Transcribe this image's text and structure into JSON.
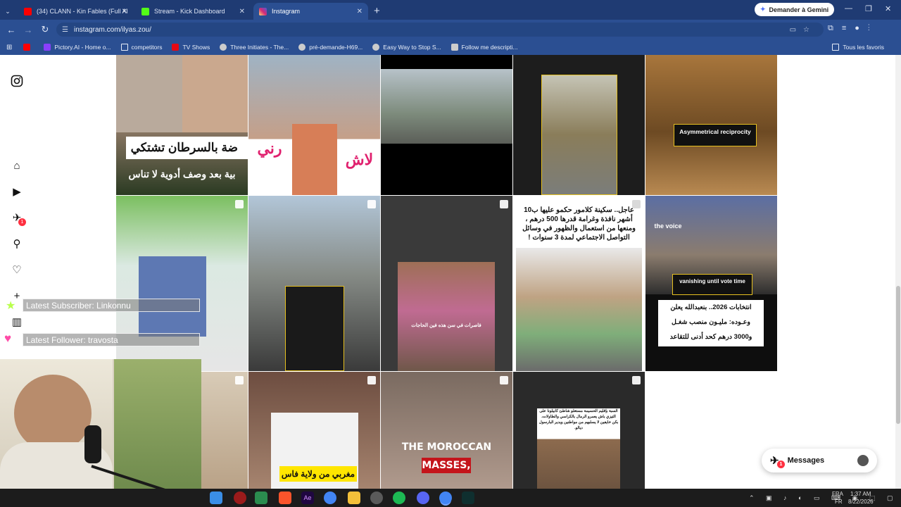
{
  "browser": {
    "tabs": [
      {
        "title": "(34) CLANN - Kin Fables (Full Al",
        "fav_color": "#ff0000",
        "active": false
      },
      {
        "title": "Stream - Kick Dashboard",
        "fav_color": "#53fc18",
        "active": false
      },
      {
        "title": "Instagram",
        "fav_color": "#d62976",
        "active": true
      }
    ],
    "new_tab": "+",
    "gemini_button": "Demander à Gemini",
    "url": "instagram.com/ilyas.zou/",
    "bookmarks": [
      {
        "label": "",
        "color": "#ff0000"
      },
      {
        "label": "Pictory.AI - Home o...",
        "color": "#8a3ffc"
      },
      {
        "label": "competitors",
        "color": "#e8c468"
      },
      {
        "label": "TV Shows",
        "color": "#e50914"
      },
      {
        "label": "Three Initiates - The...",
        "color": "#cccccc"
      },
      {
        "label": "pré-demande-H69...",
        "color": "#cccccc"
      },
      {
        "label": "Easy Way to Stop S...",
        "color": "#cccccc"
      },
      {
        "label": "Follow me descripti...",
        "color": "#cccccc"
      }
    ],
    "all_bookmarks": "Tous les favoris"
  },
  "instagram": {
    "notifications_badge": "1",
    "messages_label": "Messages",
    "messages_badge": "1",
    "posts": [
      {
        "caption": "ضة بالسرطان تشتكي\nبية بعد وصف أدوية لا تناس"
      },
      {
        "caption": "لاش\nنت ؟"
      },
      {
        "caption": ""
      },
      {
        "caption": ""
      },
      {
        "caption": "Asymmetrical reciprocity"
      },
      {
        "caption": ""
      },
      {
        "caption": ""
      },
      {
        "caption": "فاصرات في سن هذه فين الحاجات"
      },
      {
        "caption": "عاجل.. سكينة كلامور حكمو عليها ب10 أشهر نافذة وغرامة قدرها 500 درهم ، ومنعها من استعمال والظهور في وسائل التواصل الاجتماعي لمدة 3 سنوات !"
      },
      {
        "caption": "vanishing until vote time",
        "caption2": "انتخابات 2026.. بنعبدالله يعلن\nوعـوده: مليـون منصب شغـل\nو3000 درهم كحد أدنى للتقاعد",
        "logo": "the voice"
      },
      {
        "caption": ""
      },
      {
        "caption": "مغربي من ولاية فاس"
      },
      {
        "caption": "THE MOROCCAN",
        "caption2": "MASSES,"
      },
      {
        "caption": "السبة بإقليم الحسيمة مستغلو شاطئ كابيلونا على التيزي باش يعمرو الرمال بالكراسي والطاولات، بكن خايفين لا يسلبهم من مواطنين ويدير البارسول ديالو."
      }
    ]
  },
  "stream_overlay": {
    "subscriber": "Latest Subscriber: Linkonnu",
    "follower": "Latest Follower: travosta"
  },
  "taskbar": {
    "lang": "FRA",
    "region": "FR",
    "time": "1:37 AM",
    "date": "8/22/2026"
  }
}
